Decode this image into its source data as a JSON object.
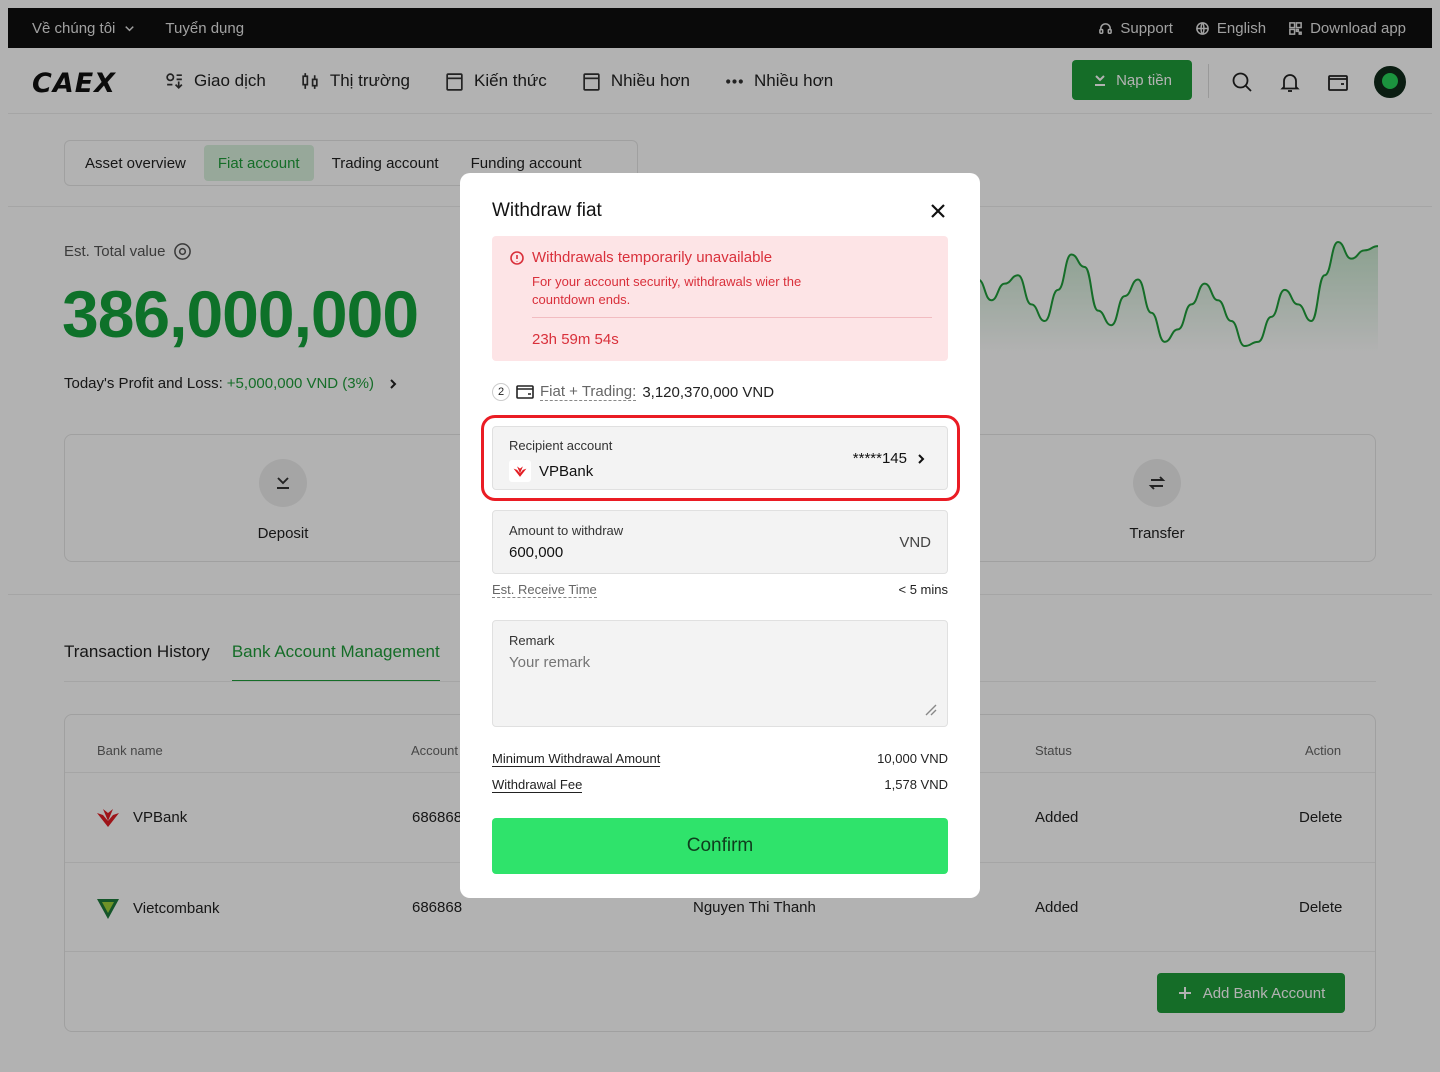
{
  "topbar": {
    "about": "Về chúng tôi",
    "careers": "Tuyển dụng",
    "support": "Support",
    "language": "English",
    "download": "Download app"
  },
  "navbar": {
    "logo": "CAEX",
    "items": [
      "Giao dịch",
      "Thị trường",
      "Kiến thức",
      "Nhiều hơn",
      "Nhiều hơn"
    ],
    "deposit_label": "Nạp tiền"
  },
  "account_tabs": [
    "Asset overview",
    "Fiat account",
    "Trading account",
    "Funding account"
  ],
  "overview": {
    "est_label": "Est. Total value",
    "total_value": "386,000,000",
    "pnl_label": "Today's Profit and Loss:",
    "pnl_value": "+5,000,000 VND (3%)"
  },
  "chart_data": {
    "type": "line",
    "values": [
      60,
      50,
      58,
      62,
      48,
      40,
      55,
      72,
      66,
      45,
      38,
      52,
      60,
      44,
      30,
      36,
      48,
      58,
      50,
      40,
      28,
      30,
      42,
      55,
      48,
      40,
      62,
      78,
      70,
      74,
      76
    ],
    "color": "#1f9d3a"
  },
  "actions": {
    "deposit": "Deposit",
    "transfer": "Transfer"
  },
  "history_tabs": [
    "Transaction History",
    "Bank Account Management"
  ],
  "table": {
    "headers": {
      "bank": "Bank name",
      "account": "Account",
      "status": "Status",
      "action": "Action"
    },
    "rows": [
      {
        "bank": "VPBank",
        "account": "686868",
        "holder": "",
        "status": "Added",
        "action": "Delete"
      },
      {
        "bank": "Vietcombank",
        "account": "686868",
        "holder": "Nguyen Thi Thanh",
        "status": "Added",
        "action": "Delete"
      }
    ],
    "add_label": "Add Bank Account"
  },
  "modal": {
    "title": "Withdraw fiat",
    "warning": {
      "title": "Withdrawals temporarily unavailable",
      "text": "For your account security, withdrawals wier the countdown ends.",
      "timer": "23h 59m 54s"
    },
    "balance": {
      "count": "2",
      "label": "Fiat + Trading:",
      "value": "3,120,370,000 VND"
    },
    "recipient": {
      "label": "Recipient account",
      "bank": "VPBank",
      "account_masked": "*****145"
    },
    "amount": {
      "label": "Amount to withdraw",
      "value": "600,000",
      "unit": "VND"
    },
    "receive_time": {
      "label": "Est. Receive Time",
      "value": "< 5 mins"
    },
    "remark": {
      "label": "Remark",
      "placeholder": "Your remark"
    },
    "min_withdrawal": {
      "label": "Minimum Withdrawal Amount",
      "value": "10,000 VND"
    },
    "fee": {
      "label": "Withdrawal Fee",
      "value": "1,578 VND"
    },
    "confirm_label": "Confirm"
  },
  "colors": {
    "brand_green": "#1f9d3a",
    "confirm_green": "#2fe36b",
    "warning_red": "#d9303b",
    "highlight_red": "#ea1c24"
  }
}
